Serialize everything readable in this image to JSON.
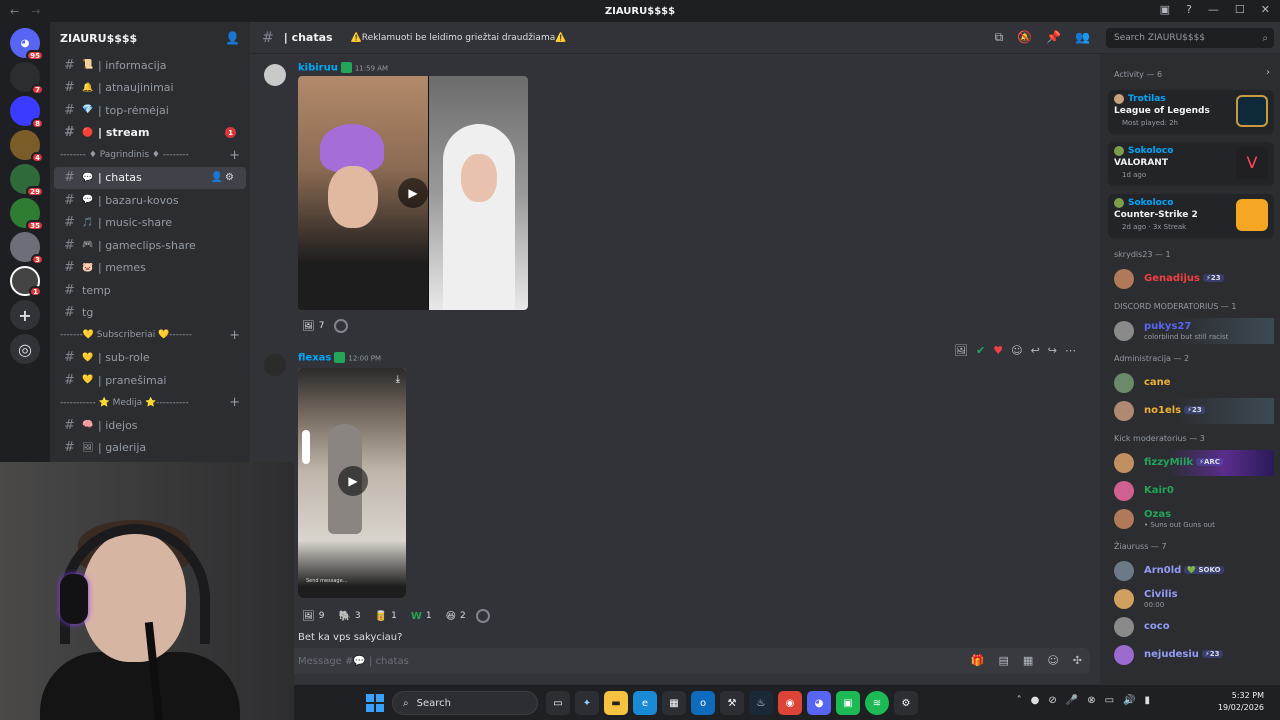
{
  "window": {
    "title": "ZIAURU$$$$",
    "back_glyph": "←",
    "fwd_glyph": "→"
  },
  "rail": {
    "servers": [
      {
        "label": "",
        "badge": "95",
        "color": "#5865f2"
      },
      {
        "label": "",
        "badge": "7",
        "color": "#2b2d31"
      },
      {
        "label": "",
        "badge": "8",
        "color": "#3b3bff"
      },
      {
        "label": "",
        "badge": "4",
        "color": "#7a5c28"
      },
      {
        "label": "",
        "badge": "29",
        "color": "#2f6b3a"
      },
      {
        "label": "",
        "badge": "35",
        "color": "#2e7d32"
      },
      {
        "label": "",
        "badge": "3",
        "color": "#6d6f78"
      },
      {
        "label": "",
        "badge": "1",
        "color": "#444"
      }
    ]
  },
  "server": {
    "name": "ZIAURU$$$$"
  },
  "channels": [
    {
      "type": "ch",
      "name": "| informacija",
      "emoji": "📜",
      "style": ""
    },
    {
      "type": "ch",
      "name": "| atnaujinimai",
      "emoji": "🔔",
      "style": ""
    },
    {
      "type": "ch",
      "name": "| top-rėmėjai",
      "emoji": "💎",
      "style": ""
    },
    {
      "type": "ch",
      "name": "| stream",
      "emoji": "🔴",
      "style": "bold",
      "count": "1"
    },
    {
      "type": "cat",
      "name": "-------- ♦ Pagrindinis ♦ --------"
    },
    {
      "type": "ch",
      "name": "| chatas",
      "emoji": "💬",
      "style": "active"
    },
    {
      "type": "ch",
      "name": "| bazaru-kovos",
      "emoji": "💬",
      "style": ""
    },
    {
      "type": "ch",
      "name": "| music-share",
      "emoji": "🎵",
      "style": ""
    },
    {
      "type": "ch",
      "name": "| gameclips-share",
      "emoji": "🎮",
      "style": ""
    },
    {
      "type": "ch",
      "name": "| memes",
      "emoji": "🐷",
      "style": ""
    },
    {
      "type": "ch",
      "name": "temp",
      "emoji": "",
      "style": ""
    },
    {
      "type": "ch",
      "name": "tg",
      "emoji": "",
      "style": ""
    },
    {
      "type": "cat",
      "name": "-------💛 Subscriberiai 💛-------"
    },
    {
      "type": "ch",
      "name": "| sub-role",
      "emoji": "💛",
      "style": ""
    },
    {
      "type": "ch",
      "name": "| pranešimai",
      "emoji": "💛",
      "style": ""
    },
    {
      "type": "cat",
      "name": "----------- ⭐ Medija ⭐----------"
    },
    {
      "type": "ch",
      "name": "| idejos",
      "emoji": "🧠",
      "style": ""
    },
    {
      "type": "ch",
      "name": "| galerija",
      "emoji": "🖼",
      "style": ""
    }
  ],
  "header": {
    "channel": "| chatas",
    "topic": "⚠️Reklamuoti be leidimo griežtai draudžiama⚠️"
  },
  "search": {
    "placeholder": "Search ZIAURU$$$$"
  },
  "messages": [
    {
      "author": "kibiruu",
      "time": "11:59 AM",
      "reactions": [
        {
          "emoji": "🖼",
          "count": "7"
        }
      ]
    },
    {
      "author": "flexas",
      "time": "12:00 PM",
      "reactions": [
        {
          "emoji": "🖼",
          "count": "9"
        },
        {
          "emoji": "🐘",
          "count": "3"
        },
        {
          "emoji": "🥫",
          "count": "1"
        },
        {
          "emoji": "W",
          "count": "1"
        },
        {
          "emoji": "😆",
          "count": "2"
        }
      ],
      "video_overlay_text": "Send message..."
    }
  ],
  "partial_message": "Bet ka vps sakyciau?",
  "composer": {
    "placeholder": "Message #💬 | chatas"
  },
  "members": {
    "activity_header": "Activity — 6",
    "activities": [
      {
        "who": "Trotilas",
        "game": "League of Legends",
        "meta": "Most played: 2h",
        "art": "#c89b3c"
      },
      {
        "who": "Sokoloco",
        "game": "VALORANT",
        "meta": "1d ago",
        "art": "#1f1f24"
      },
      {
        "who": "Sokoloco",
        "game": "Counter-Strike 2",
        "meta": "2d ago · 3x Streak",
        "art": "#f5a623"
      }
    ],
    "groups": [
      {
        "title": "skrydis23 — 1",
        "items": [
          {
            "name": "Genadijus",
            "tag": "⚡23",
            "color": "#f23f43",
            "sub": ""
          }
        ]
      },
      {
        "title": "DISCORD MODERATORIUS — 1",
        "items": [
          {
            "name": "pukys27",
            "tag": "",
            "color": "#5865f2",
            "sub": "colorblind but still racist",
            "banner": "1"
          }
        ]
      },
      {
        "title": "Administracija — 2",
        "items": [
          {
            "name": "cane",
            "tag": "",
            "color": "#f0b232",
            "sub": ""
          },
          {
            "name": "no1els",
            "tag": "⚡23",
            "color": "#f0b232",
            "sub": "",
            "banner": "1"
          }
        ]
      },
      {
        "title": "Kick moderatorius — 3",
        "items": [
          {
            "name": "fizzyMilk",
            "tag": "⚡ARC",
            "color": "#23a55a",
            "sub": "",
            "banner": "2"
          },
          {
            "name": "Kair0",
            "tag": "",
            "color": "#23a55a",
            "sub": ""
          },
          {
            "name": "Ozas",
            "tag": "",
            "color": "#23a55a",
            "sub": "• Suns out Guns out"
          }
        ]
      },
      {
        "title": "Žiauruss — 7",
        "items": [
          {
            "name": "Arn0ld",
            "tag": "💚 SOKO",
            "color": "#949cf7",
            "sub": ""
          },
          {
            "name": "Civilis",
            "tag": "",
            "color": "#949cf7",
            "sub": "00:00"
          },
          {
            "name": "coco",
            "tag": "",
            "color": "#949cf7",
            "sub": ""
          },
          {
            "name": "nejudesiu",
            "tag": "⚡23",
            "color": "#949cf7",
            "sub": ""
          }
        ]
      }
    ]
  },
  "taskbar": {
    "search_label": "Search",
    "time": "5:32 PM",
    "date": "19/02/2026"
  }
}
